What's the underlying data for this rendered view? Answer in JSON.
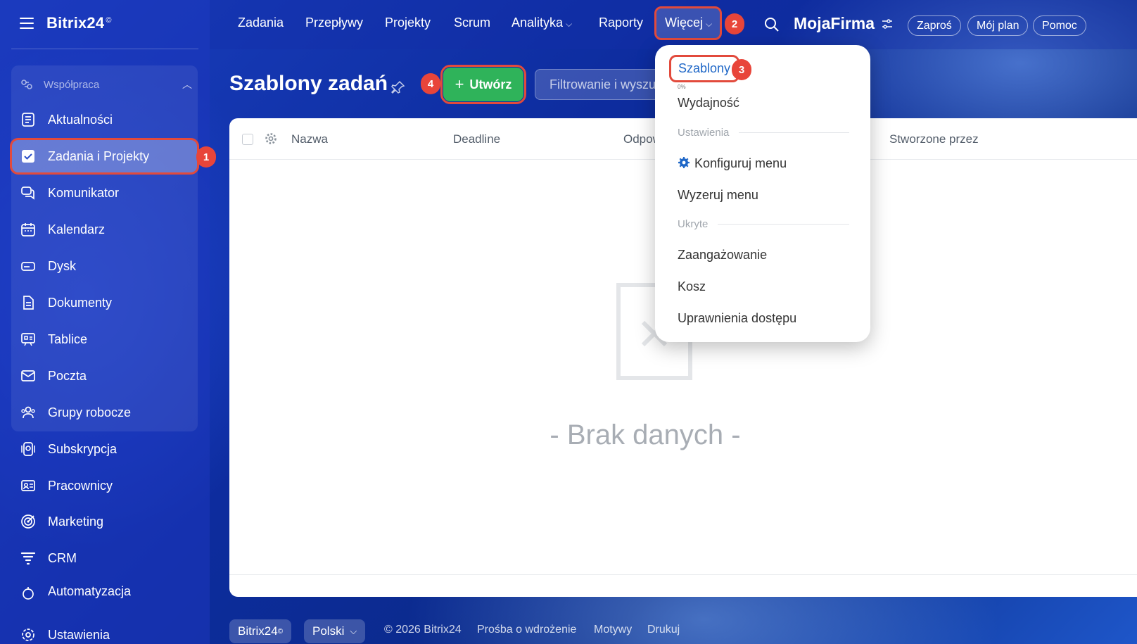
{
  "app": {
    "logo": "Bitrix24",
    "logo_mark": "©"
  },
  "sidebar": {
    "group_label": "Współpraca",
    "items": [
      {
        "label": "Aktualności"
      },
      {
        "label": "Zadania i Projekty",
        "badge": "1"
      },
      {
        "label": "Komunikator"
      },
      {
        "label": "Kalendarz"
      },
      {
        "label": "Dysk"
      },
      {
        "label": "Dokumenty"
      },
      {
        "label": "Tablice"
      },
      {
        "label": "Poczta"
      },
      {
        "label": "Grupy robocze"
      },
      {
        "label": "Subskrypcja"
      },
      {
        "label": "Pracownicy"
      },
      {
        "label": "Marketing"
      },
      {
        "label": "CRM"
      },
      {
        "label": "Automatyzacja"
      },
      {
        "label": "Ustawienia"
      }
    ]
  },
  "topnav": {
    "items": [
      "Zadania",
      "Przepływy",
      "Projekty",
      "Scrum",
      "Analityka",
      "Raporty"
    ],
    "more_label": "Więcej",
    "more_badge": "2",
    "company": "MojaFirma",
    "invite": "Zaproś",
    "plan": "Mój plan",
    "help": "Pomoc"
  },
  "page": {
    "title": "Szablony zadań",
    "create_label": "Utwórz",
    "create_badge": "4",
    "filter_placeholder": "Filtrowanie i wyszukiwanie"
  },
  "table": {
    "columns": [
      "Nazwa",
      "Deadline",
      "Odpowiedzialny",
      "Stworzone przez"
    ],
    "empty_text": "- Brak danych -"
  },
  "menu": {
    "templates": "Szablony",
    "templates_badge": "3",
    "tiny": "0%",
    "efficiency": "Wydajność",
    "settings_section": "Ustawienia",
    "configure": "Konfiguruj menu",
    "reset": "Wyzeruj menu",
    "hidden_section": "Ukryte",
    "engagement": "Zaangażowanie",
    "trash": "Kosz",
    "permissions": "Uprawnienia dostępu"
  },
  "footer": {
    "brand": "Bitrix24",
    "language": "Polski",
    "copyright": "© 2026 Bitrix24",
    "implementation": "Prośba o wdrożenie",
    "themes": "Motywy",
    "print": "Drukuj"
  },
  "colors": {
    "accent_blue": "#1f67c7",
    "create_green": "#2fb35a",
    "highlight_red": "#e24a3c"
  }
}
